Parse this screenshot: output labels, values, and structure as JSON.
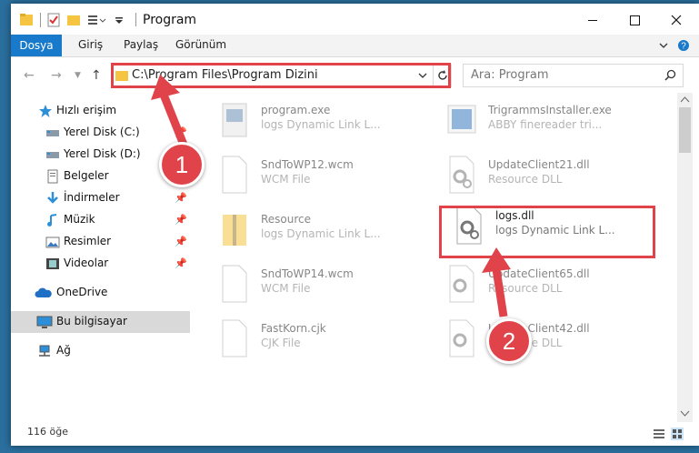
{
  "window": {
    "title": "Program"
  },
  "ribbon": {
    "tabs": [
      "Dosya",
      "Giriş",
      "Paylaş",
      "Görünüm"
    ]
  },
  "address": {
    "path": "C:\\Program Files\\Program Dizini"
  },
  "search": {
    "placeholder": "Ara: Program"
  },
  "nav": {
    "items": [
      {
        "label": "Hızlı erişim",
        "icon": "star-icon"
      },
      {
        "label": "Yerel Disk (C:)",
        "icon": "drive-icon"
      },
      {
        "label": "Yerel Disk (D:)",
        "icon": "drive-icon"
      },
      {
        "label": "Belgeler",
        "icon": "documents-icon"
      },
      {
        "label": "İndirmeler",
        "icon": "download-icon"
      },
      {
        "label": "Müzik",
        "icon": "music-icon"
      },
      {
        "label": "Resimler",
        "icon": "pictures-icon"
      },
      {
        "label": "Videolar",
        "icon": "videos-icon"
      },
      {
        "label": "OneDrive",
        "icon": "cloud-icon"
      },
      {
        "label": "Bu bilgisayar",
        "icon": "computer-icon"
      },
      {
        "label": "Ağ",
        "icon": "network-icon"
      }
    ]
  },
  "files": [
    {
      "name": "program.exe",
      "type": "logs Dynamic Link L..."
    },
    {
      "name": "TrigrammsInstaller.exe",
      "type": "ABBY finereader tri..."
    },
    {
      "name": "SndToWP12.wcm",
      "type": "WCM File"
    },
    {
      "name": "UpdateClient21.dll",
      "type": "Resource DLL"
    },
    {
      "name": "Resource",
      "type": "logs Dynamic Link L..."
    },
    {
      "name": "logs.dll",
      "type": "logs Dynamic Link L..."
    },
    {
      "name": "SndToWP14.wcm",
      "type": "WCM File"
    },
    {
      "name": "UpdateClient65.dll",
      "type": "Resource DLL"
    },
    {
      "name": "FastKorn.cjk",
      "type": "CJK File"
    },
    {
      "name": "UpdateClient42.dll",
      "type": "Resource DLL"
    }
  ],
  "status": {
    "count": "116 öğe"
  },
  "annotations": {
    "badge1": "1",
    "badge2": "2"
  },
  "colors": {
    "accent": "#1979ca",
    "highlight": "#e0444a",
    "selection": "#d9d9d9"
  }
}
